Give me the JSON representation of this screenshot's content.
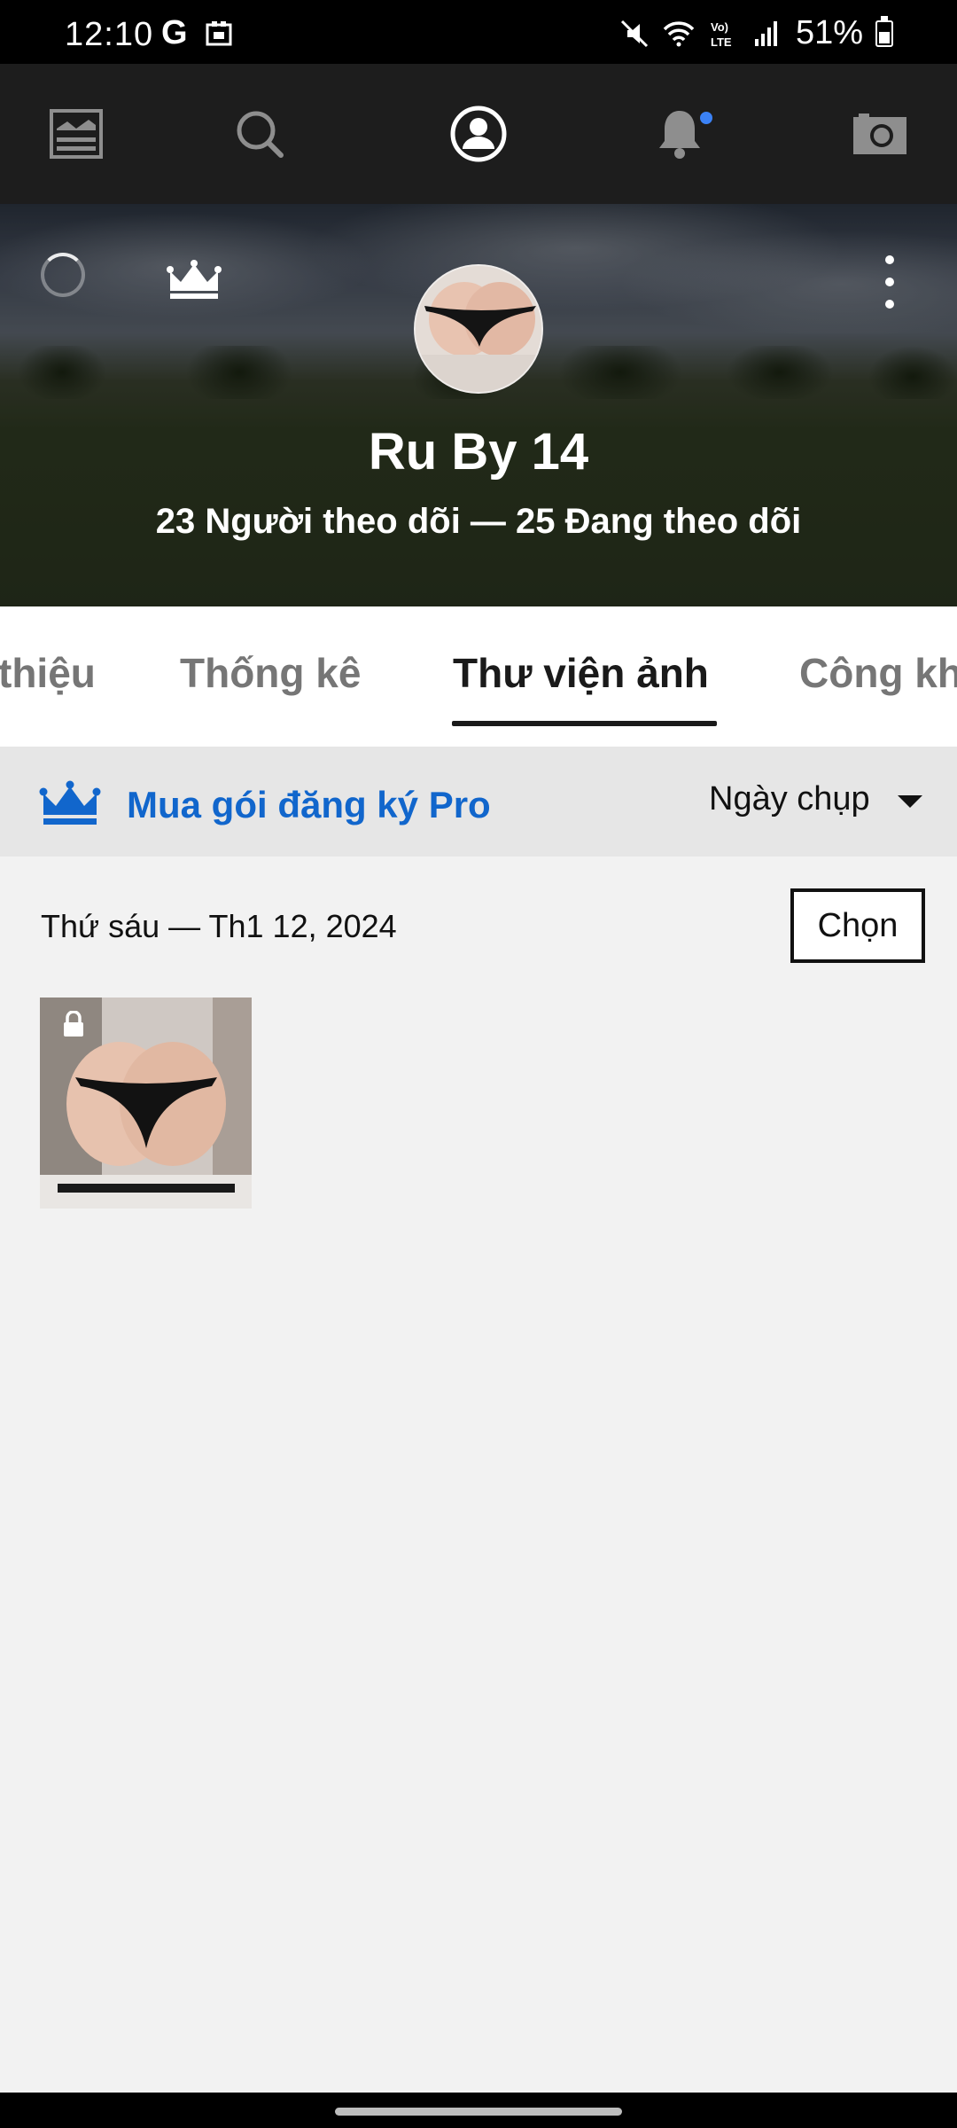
{
  "status": {
    "time": "12:10",
    "google_glyph": "G",
    "battery_text": "51%",
    "icons": [
      "google-icon",
      "gallery-notification-icon",
      "mute-icon",
      "wifi-icon",
      "volte-icon",
      "signal-icon",
      "battery-icon"
    ]
  },
  "nav": {
    "items": [
      "feed-icon",
      "search-icon",
      "profile-icon",
      "notifications-icon",
      "camera-icon"
    ],
    "active": "profile-icon",
    "notification_dot_color": "#3b82f6"
  },
  "profile": {
    "name": "Ru By 14",
    "followers_line": "23 Người theo dõi — 25 Đang theo dõi"
  },
  "tabs": [
    {
      "label": "thiệu",
      "active": false
    },
    {
      "label": "Thống kê",
      "active": false
    },
    {
      "label": "Thư viện ảnh",
      "active": true
    },
    {
      "label": "Công kh",
      "active": false
    }
  ],
  "pro_bar": {
    "label": "Mua gói đăng ký Pro",
    "sort_label": "Ngày chụp",
    "accent": "#1166cc"
  },
  "gallery": {
    "date_header": "Thứ sáu — Th1 12, 2024",
    "select_label": "Chọn",
    "items": [
      {
        "locked": true
      }
    ]
  }
}
